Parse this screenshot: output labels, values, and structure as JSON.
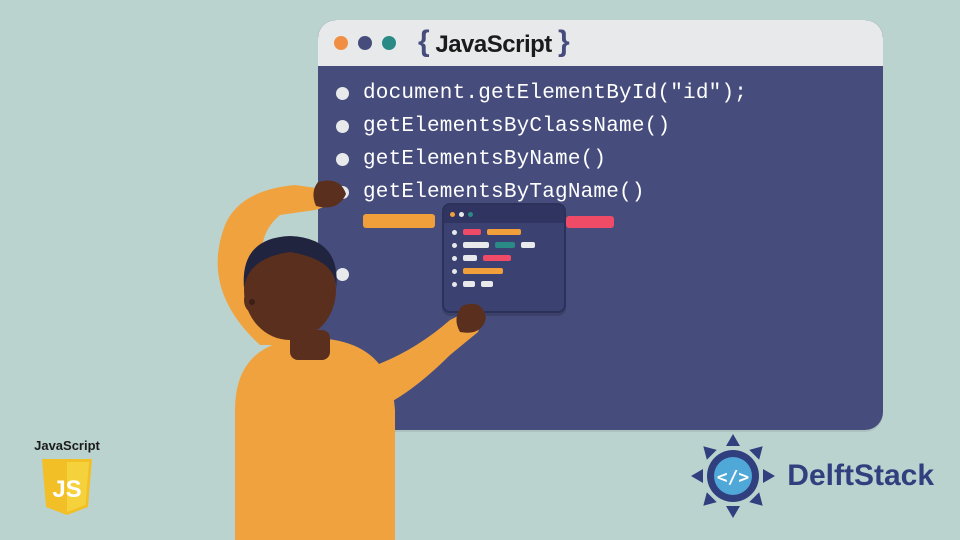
{
  "editor": {
    "title_left_brace": "{",
    "title_text": " JavaScript ",
    "title_right_brace": "}",
    "lines": [
      "document.getElementById(\"id\");",
      "getElementsByClassName()",
      "getElementsByName()",
      "getElementsByTagName()"
    ]
  },
  "js_badge": {
    "label": "JavaScript",
    "letters": "JS"
  },
  "delftstack": {
    "name": "DelftStack"
  },
  "colors": {
    "bg": "#bbd3cf",
    "panel": "#464d7c",
    "titlebar": "#e7e9ea",
    "orange": "#f19f3a",
    "teal": "#2a8a85",
    "pink": "#ef4a66",
    "brand_blue": "#30407f"
  }
}
